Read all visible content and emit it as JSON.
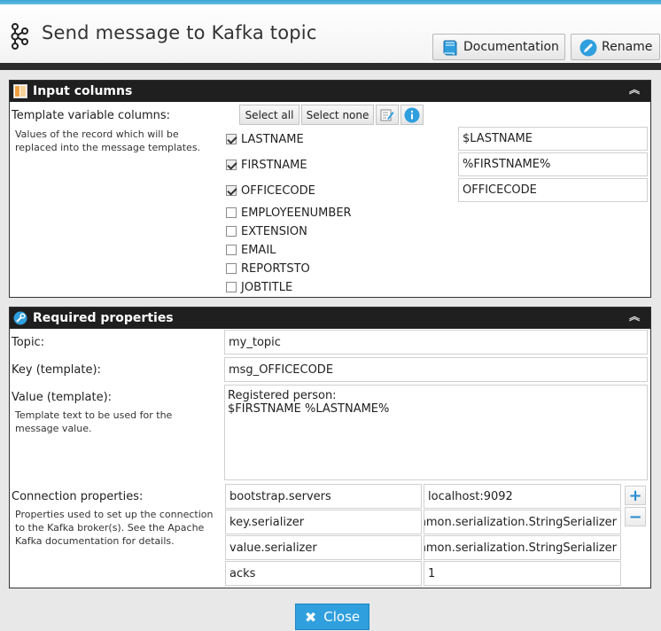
{
  "header": {
    "title": "Send message to Kafka topic",
    "documentation_label": "Documentation",
    "rename_label": "Rename"
  },
  "input_columns": {
    "title": "Input columns",
    "template_label": "Template variable columns:",
    "template_hint": "Values of the record which will be replaced into the message templates.",
    "select_all": "Select all",
    "select_none": "Select none",
    "columns": [
      {
        "name": "LASTNAME",
        "checked": true,
        "value": "$LASTNAME"
      },
      {
        "name": "FIRSTNAME",
        "checked": true,
        "value": "%FIRSTNAME%"
      },
      {
        "name": "OFFICECODE",
        "checked": true,
        "value": "OFFICECODE"
      },
      {
        "name": "EMPLOYEENUMBER",
        "checked": false
      },
      {
        "name": "EXTENSION",
        "checked": false
      },
      {
        "name": "EMAIL",
        "checked": false
      },
      {
        "name": "REPORTSTO",
        "checked": false
      },
      {
        "name": "JOBTITLE",
        "checked": false
      }
    ]
  },
  "required_properties": {
    "title": "Required properties",
    "topic_label": "Topic:",
    "topic_value": "my_topic",
    "key_label": "Key (template):",
    "key_value": "msg_OFFICECODE",
    "value_label": "Value (template):",
    "value_hint": "Template text to be used for the message value.",
    "value_text": "Registered person:\n$FIRSTNAME %LASTNAME%",
    "conn_label": "Connection properties:",
    "conn_hint": "Properties used to set up the connection to the Kafka broker(s). See the Apache Kafka documentation for details.",
    "connection": [
      {
        "key": "bootstrap.servers",
        "value": "localhost:9092"
      },
      {
        "key": "key.serializer",
        "value": "org.apache.kafka.common.serialization.StringSerializer"
      },
      {
        "key": "value.serializer",
        "value": "org.apache.kafka.common.serialization.StringSerializer"
      },
      {
        "key": "acks",
        "value": "1"
      }
    ],
    "add_symbol": "+",
    "remove_symbol": "−"
  },
  "footer": {
    "close_label": "Close"
  },
  "colors": {
    "accent": "#2f9fde",
    "panel_header": "#1f1f1f"
  }
}
